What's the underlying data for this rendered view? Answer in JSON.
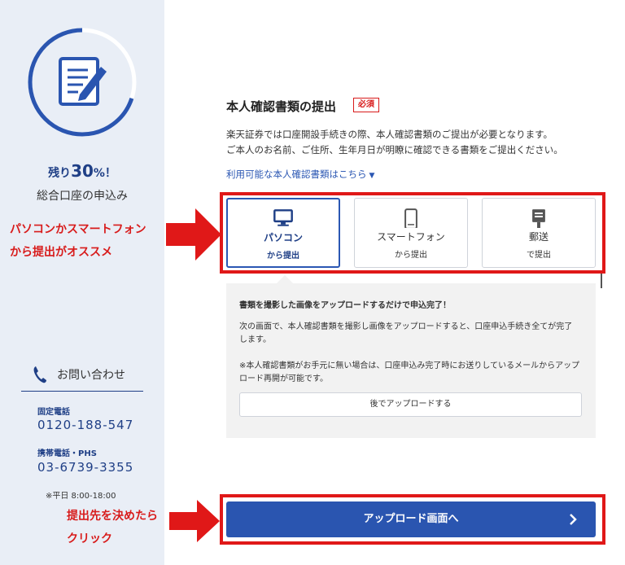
{
  "sidebar": {
    "progress_prefix": "残り",
    "progress_value": "30",
    "progress_suffix": "%！",
    "progress_fraction": 0.7,
    "subtitle": "総合口座の申込み",
    "contact_title": "お問い合わせ",
    "landline_label": "固定電話",
    "landline_number": "0120-188-547",
    "mobile_label": "携帯電話・PHS",
    "mobile_number": "03-6739-3355",
    "hours": "※平日 8:00-18:00"
  },
  "annotations": {
    "recommend_line1": "パソコンかスマートフォン",
    "recommend_line2": "から提出がオススメ",
    "click_line1": "提出先を決めたら",
    "click_line2": "クリック"
  },
  "main": {
    "title": "本人確認書類の提出",
    "required_badge": "必須",
    "desc_line1": "楽天証券では口座開設手続きの際、本人確認書類のご提出が必要となります。",
    "desc_line2": "ご本人のお名前、ご住所、生年月日が明瞭に確認できる書類をご提出ください。",
    "available_docs_link": "利用可能な本人確認書類はこちら",
    "options": [
      {
        "icon": "monitor-icon",
        "line1": "パソコン",
        "line2": "から提出",
        "selected": true
      },
      {
        "icon": "smartphone-icon",
        "line1": "スマートフォン",
        "line2": "から提出",
        "selected": false
      },
      {
        "icon": "mailbox-icon",
        "line1": "郵送",
        "line2": "で提出",
        "selected": false
      }
    ],
    "panel": {
      "heading": "書類を撮影した画像をアップロードするだけで申込完了！",
      "text1_line1": "次の画面で、本人確認書類を撮影し画像をアップロードすると、口座申込手続き全てが完了",
      "text1_line2": "します。",
      "text2_line1": "※本人確認書類がお手元に無い場合は、口座申込み完了時にお送りしているメールからアップ",
      "text2_line2": "ロード再開が可能です。",
      "later_button": "後でアップロードする"
    },
    "primary_button": "アップロード画面へ"
  },
  "colors": {
    "accent": "#2a55b0",
    "annotation_red": "#e01818",
    "sidebar_bg": "#e9eef6"
  }
}
